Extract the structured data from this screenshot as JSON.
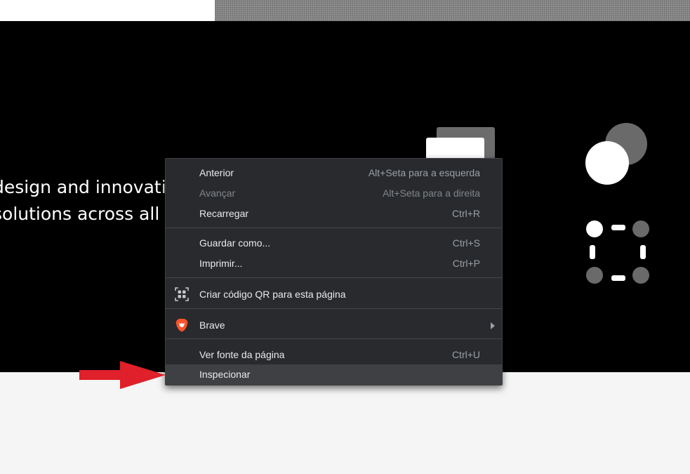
{
  "hero": {
    "line1": "design and innovation",
    "line2": "solutions across all industries"
  },
  "context_menu": {
    "items": [
      {
        "label": "Anterior",
        "shortcut": "Alt+Seta para a esquerda",
        "enabled": true
      },
      {
        "label": "Avançar",
        "shortcut": "Alt+Seta para a direita",
        "enabled": false
      },
      {
        "label": "Recarregar",
        "shortcut": "Ctrl+R",
        "enabled": true
      },
      {
        "label": "Guardar como...",
        "shortcut": "Ctrl+S",
        "enabled": true
      },
      {
        "label": "Imprimir...",
        "shortcut": "Ctrl+P",
        "enabled": true
      },
      {
        "label": "Criar código QR para esta página",
        "icon": "qr-code-icon"
      },
      {
        "label": "Brave",
        "icon": "brave-lion-icon",
        "submenu": true
      },
      {
        "label": "Ver fonte da página",
        "shortcut": "Ctrl+U",
        "enabled": true
      },
      {
        "label": "Inspecionar",
        "highlighted": true
      }
    ]
  },
  "colors": {
    "menu_background": "#292a2d",
    "menu_highlight": "#3f4043",
    "hero_background": "#000000",
    "annotation_arrow": "#e0202a",
    "brave_orange": "#fb542b"
  }
}
